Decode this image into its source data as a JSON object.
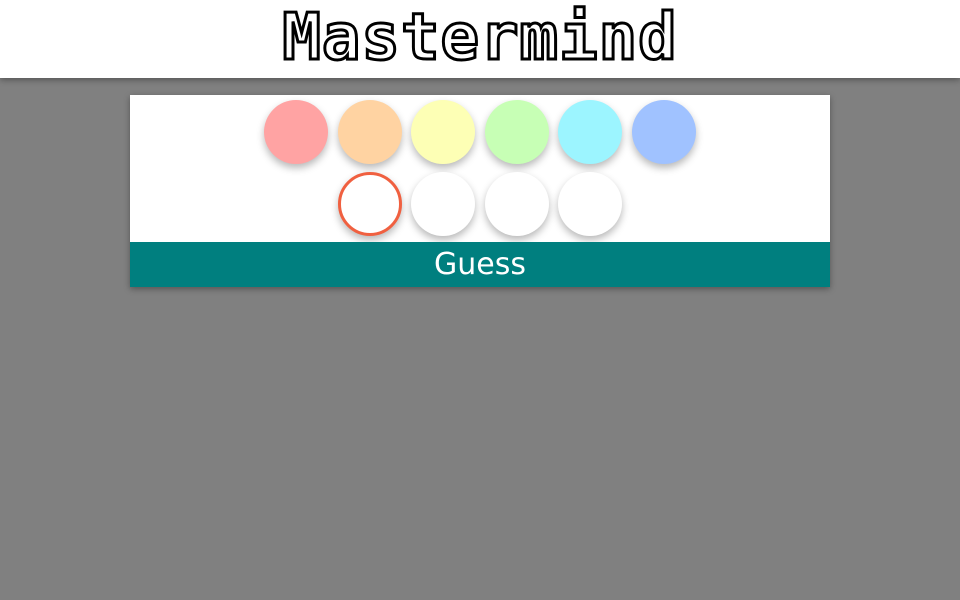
{
  "header": {
    "title": "Mastermind"
  },
  "palette": [
    {
      "name": "red",
      "color": "#ffa3a3"
    },
    {
      "name": "orange",
      "color": "#ffd3a2"
    },
    {
      "name": "yellow",
      "color": "#fdffb5"
    },
    {
      "name": "green",
      "color": "#c7ffb5"
    },
    {
      "name": "cyan",
      "color": "#9cf5ff"
    },
    {
      "name": "blue",
      "color": "#a0c2ff"
    }
  ],
  "guess_row": {
    "slots": [
      {
        "color": "#ffffff",
        "selected": true
      },
      {
        "color": "#ffffff",
        "selected": false
      },
      {
        "color": "#ffffff",
        "selected": false
      },
      {
        "color": "#ffffff",
        "selected": false
      }
    ],
    "selected_border_color": "#f06040"
  },
  "guess_button": {
    "label": "Guess",
    "color": "#007f7f"
  }
}
